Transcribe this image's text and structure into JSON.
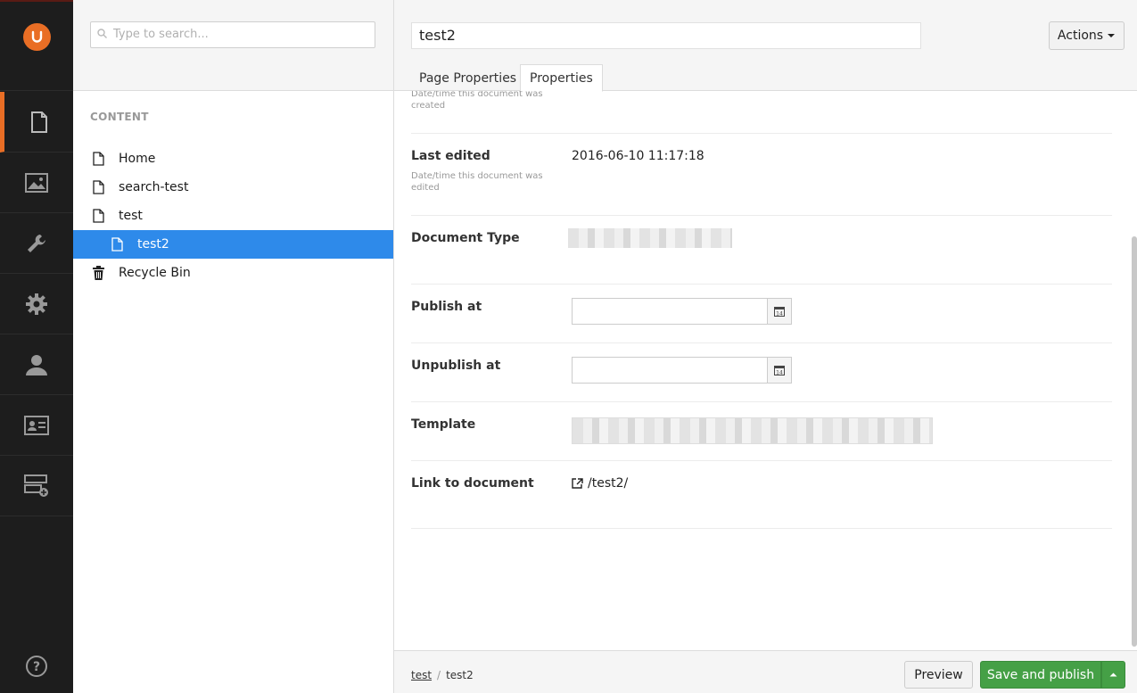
{
  "rail": {
    "items": [
      "content-icon",
      "media-icon",
      "settings-wrench-icon",
      "developer-gear-icon",
      "users-icon",
      "members-icon",
      "forms-icon"
    ],
    "help_icon": "help-icon"
  },
  "search": {
    "placeholder": "Type to search..."
  },
  "tree": {
    "section_label": "CONTENT",
    "items": [
      {
        "label": "Home",
        "icon": "document-icon"
      },
      {
        "label": "search-test",
        "icon": "document-icon"
      },
      {
        "label": "test",
        "icon": "document-icon"
      },
      {
        "label": "test2",
        "icon": "document-icon",
        "selected": true
      },
      {
        "label": "Recycle Bin",
        "icon": "trash-icon"
      }
    ]
  },
  "editor": {
    "name": "test2",
    "actions_label": "Actions",
    "tabs": [
      "Page Properties",
      "Properties"
    ],
    "active_tab": "Properties",
    "properties": {
      "created_desc": "Date/time this document was created",
      "last_edited_label": "Last edited",
      "last_edited_desc": "Date/time this document was edited",
      "last_edited_value": "2016-06-10 11:17:18",
      "document_type_label": "Document Type",
      "publish_at_label": "Publish at",
      "unpublish_at_label": "Unpublish at",
      "template_label": "Template",
      "link_label": "Link to document",
      "link_value": "/test2/"
    }
  },
  "footer": {
    "breadcrumb": [
      "test",
      "test2"
    ],
    "preview_label": "Preview",
    "publish_label": "Save and publish"
  },
  "colors": {
    "accent": "#e96e25",
    "selected": "#2e8aea",
    "publish": "#45a046",
    "rail": "#1d1d1d"
  }
}
